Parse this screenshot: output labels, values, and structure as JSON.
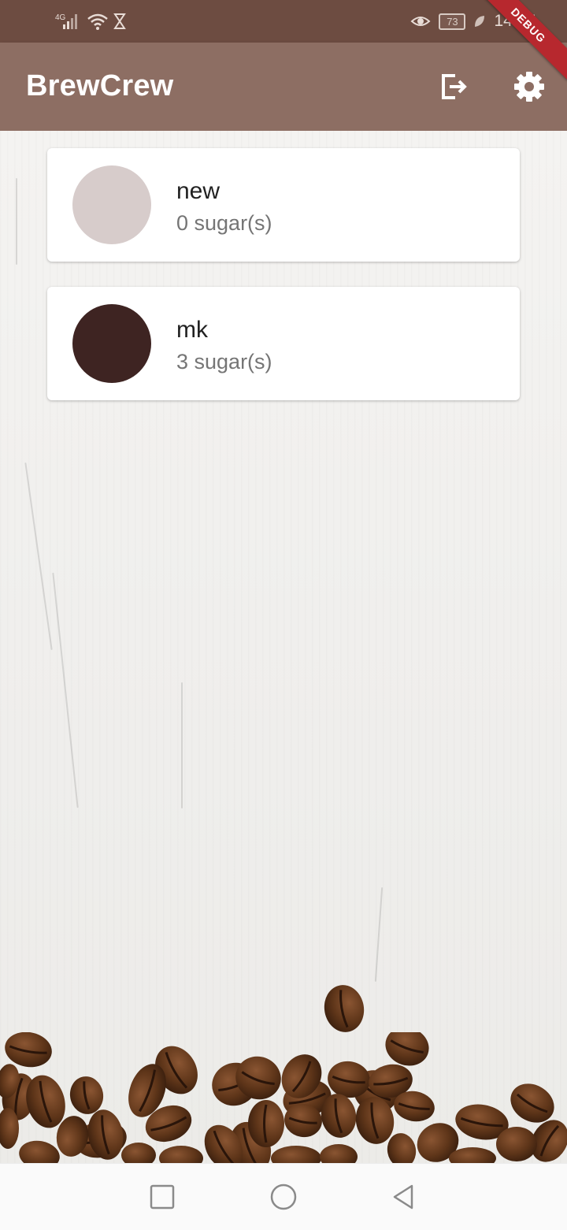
{
  "status_bar": {
    "network": "4G",
    "battery": "73",
    "time": "14:47"
  },
  "debug_banner": "DEBUG",
  "app_bar": {
    "title": "BrewCrew",
    "actions": [
      {
        "icon": "logout-icon"
      },
      {
        "icon": "settings-gear-icon"
      }
    ]
  },
  "brews": [
    {
      "name": "new",
      "sugars": "0 sugar(s)",
      "color": "#d7cccb"
    },
    {
      "name": "mk",
      "sugars": "3 sugar(s)",
      "color": "#3e2422"
    }
  ],
  "nav_bar": {
    "buttons": [
      {
        "icon": "recents-square-icon"
      },
      {
        "icon": "home-circle-icon"
      },
      {
        "icon": "back-triangle-icon"
      }
    ]
  },
  "colors": {
    "status_bar": "#6d4c41",
    "app_bar": "#8d6e63",
    "card": "#ffffff",
    "debug": "#b7282e"
  }
}
